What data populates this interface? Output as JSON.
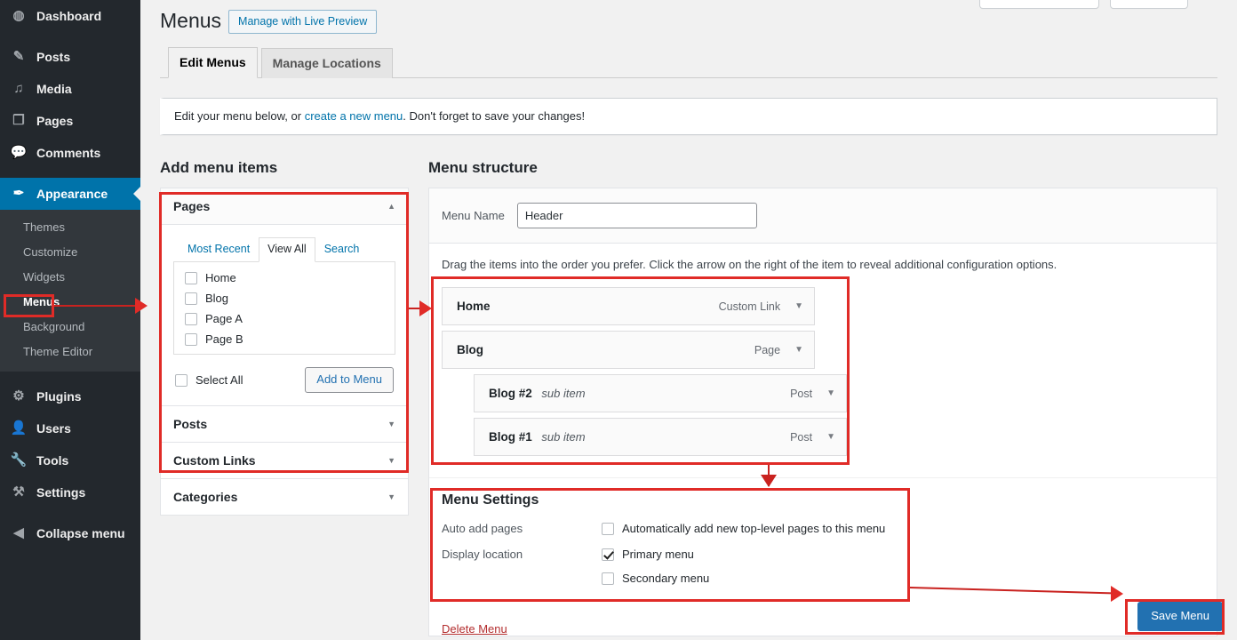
{
  "sidebar": {
    "top_items": [
      {
        "label": "Dashboard",
        "icon": "dashboard-icon",
        "glyph": "◍"
      },
      {
        "label": "Posts",
        "icon": "pin-icon",
        "glyph": "✎"
      },
      {
        "label": "Media",
        "icon": "media-icon",
        "glyph": "♫"
      },
      {
        "label": "Pages",
        "icon": "pages-icon",
        "glyph": "❐"
      },
      {
        "label": "Comments",
        "icon": "comments-icon",
        "glyph": "💬"
      }
    ],
    "appearance": {
      "label": "Appearance",
      "icon": "appearance-brush-icon",
      "glyph": "✒",
      "active": true
    },
    "appearance_sub": [
      {
        "label": "Themes"
      },
      {
        "label": "Customize"
      },
      {
        "label": "Widgets"
      },
      {
        "label": "Menus",
        "current": true
      },
      {
        "label": "Background"
      },
      {
        "label": "Theme Editor"
      }
    ],
    "bottom_items": [
      {
        "label": "Plugins",
        "icon": "plugins-icon",
        "glyph": "⚙"
      },
      {
        "label": "Users",
        "icon": "users-icon",
        "glyph": "👤"
      },
      {
        "label": "Tools",
        "icon": "tools-wrench-icon",
        "glyph": "🔧"
      },
      {
        "label": "Settings",
        "icon": "settings-sliders-icon",
        "glyph": "⚒"
      },
      {
        "label": "Collapse menu",
        "icon": "collapse-icon",
        "glyph": "◀"
      }
    ]
  },
  "header": {
    "title": "Menus",
    "live_preview_button": "Manage with Live Preview",
    "tabs": [
      {
        "label": "Edit Menus",
        "active": true
      },
      {
        "label": "Manage Locations",
        "active": false
      }
    ]
  },
  "notice": {
    "text_before": "Edit your menu below, or ",
    "link": "create a new menu",
    "text_after": ". Don't forget to save your changes!"
  },
  "add_menu_items": {
    "title": "Add menu items",
    "pages": {
      "label": "Pages",
      "caret": "▲",
      "tabs": [
        {
          "label": "Most Recent",
          "active": false
        },
        {
          "label": "View All",
          "active": true
        },
        {
          "label": "Search",
          "active": false
        }
      ],
      "items": [
        {
          "label": "Home",
          "checked": false
        },
        {
          "label": "Blog",
          "checked": false
        },
        {
          "label": "Page A",
          "checked": false
        },
        {
          "label": "Page B",
          "checked": false
        }
      ],
      "select_all": "Select All",
      "add_button": "Add to Menu"
    },
    "collapsed": [
      {
        "label": "Posts",
        "caret": "▼"
      },
      {
        "label": "Custom Links",
        "caret": "▼"
      },
      {
        "label": "Categories",
        "caret": "▼"
      }
    ]
  },
  "menu_structure": {
    "title": "Menu structure",
    "name_label": "Menu Name",
    "name_value": "Header",
    "name_placeholder": "Menu Name",
    "drag_hint": "Drag the items into the order you prefer. Click the arrow on the right of the item to reveal additional configuration options.",
    "items": [
      {
        "title": "Home",
        "sub": "",
        "type": "Custom Link",
        "depth": 0,
        "caret": "▼"
      },
      {
        "title": "Blog",
        "sub": "",
        "type": "Page",
        "depth": 0,
        "caret": "▼"
      },
      {
        "title": "Blog #2",
        "sub": "sub item",
        "type": "Post",
        "depth": 1,
        "caret": "▼"
      },
      {
        "title": "Blog #1",
        "sub": "sub item",
        "type": "Post",
        "depth": 1,
        "caret": "▼"
      }
    ]
  },
  "menu_settings": {
    "title": "Menu Settings",
    "auto_add_label": "Auto add pages",
    "auto_add_option": "Automatically add new top-level pages to this menu",
    "auto_add_checked": false,
    "display_label": "Display location",
    "locations": [
      {
        "label": "Primary menu",
        "checked": true
      },
      {
        "label": "Secondary menu",
        "checked": false
      }
    ]
  },
  "footer": {
    "delete_menu": "Delete Menu",
    "save_menu": "Save Menu"
  }
}
